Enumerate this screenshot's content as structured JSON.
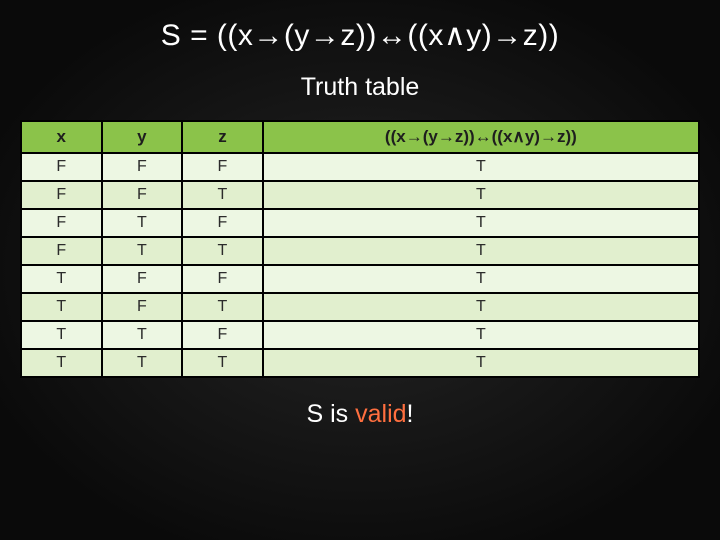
{
  "title": "S = ((x→(y→z))↔((x∧y)→z))",
  "subtitle": "Truth table",
  "headers": {
    "x": "x",
    "y": "y",
    "z": "z",
    "s": "((x→(y→z))↔((x∧y)→z))"
  },
  "rows": [
    {
      "x": "F",
      "y": "F",
      "z": "F",
      "s": "T"
    },
    {
      "x": "F",
      "y": "F",
      "z": "T",
      "s": "T"
    },
    {
      "x": "F",
      "y": "T",
      "z": "F",
      "s": "T"
    },
    {
      "x": "F",
      "y": "T",
      "z": "T",
      "s": "T"
    },
    {
      "x": "T",
      "y": "F",
      "z": "F",
      "s": "T"
    },
    {
      "x": "T",
      "y": "F",
      "z": "T",
      "s": "T"
    },
    {
      "x": "T",
      "y": "T",
      "z": "F",
      "s": "T"
    },
    {
      "x": "T",
      "y": "T",
      "z": "T",
      "s": "T"
    }
  ],
  "footer": {
    "prefix": "S is ",
    "emph": "valid",
    "suffix": "!"
  },
  "chart_data": {
    "type": "table",
    "title": "Truth table for S = ((x→(y→z))↔((x∧y)→z))",
    "columns": [
      "x",
      "y",
      "z",
      "((x→(y→z))↔((x∧y)→z))"
    ],
    "rows": [
      [
        "F",
        "F",
        "F",
        "T"
      ],
      [
        "F",
        "F",
        "T",
        "T"
      ],
      [
        "F",
        "T",
        "F",
        "T"
      ],
      [
        "F",
        "T",
        "T",
        "T"
      ],
      [
        "T",
        "F",
        "F",
        "T"
      ],
      [
        "T",
        "F",
        "T",
        "T"
      ],
      [
        "T",
        "T",
        "F",
        "T"
      ],
      [
        "T",
        "T",
        "T",
        "T"
      ]
    ]
  }
}
